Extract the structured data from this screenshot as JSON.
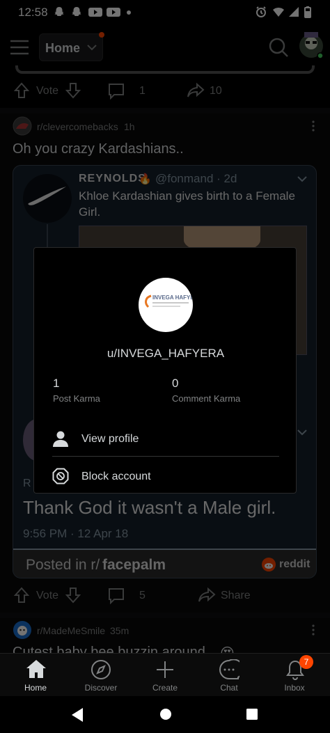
{
  "status_bar": {
    "time": "12:58"
  },
  "header": {
    "title": "Home"
  },
  "prev_post": {
    "vote_label": "Vote",
    "comments": "1",
    "shares": "10"
  },
  "post": {
    "subreddit": "r/clevercomebacks",
    "age": "1h",
    "title": "Oh you crazy Kardashians..",
    "tweet": {
      "name": "Reynolds",
      "handle": "@fonmand · 2d",
      "text": "Khloe Kardashian gives birth to a Female Girl.",
      "reply_letter": "R",
      "reply_text": "Thank God it wasn't a Male girl.",
      "reply_time": "9:56 PM · 12 Apr 18",
      "posted_in_prefix": "Posted in r/",
      "posted_in_sub": "facepalm",
      "reddit_brand": "reddit"
    },
    "vote_label": "Vote",
    "comments": "5",
    "share_label": "Share"
  },
  "next_post": {
    "subreddit": "r/MadeMeSmile",
    "age": "35m",
    "title": "Cutest baby bee buzzin around"
  },
  "modal": {
    "avatar_brand": "INVEGA HAFYERA",
    "username": "u/INVEGA_HAFYERA",
    "post_karma_value": "1",
    "post_karma_label": "Post Karma",
    "comment_karma_value": "0",
    "comment_karma_label": "Comment Karma",
    "view_profile_label": "View profile",
    "block_account_label": "Block account"
  },
  "bottom_nav": {
    "items": [
      {
        "label": "Home"
      },
      {
        "label": "Discover"
      },
      {
        "label": "Create"
      },
      {
        "label": "Chat"
      },
      {
        "label": "Inbox"
      }
    ],
    "inbox_badge": "7"
  },
  "colors": {
    "accent": "#ff4500",
    "background": "#000000",
    "text": "#d7dadc",
    "muted": "#818384"
  }
}
